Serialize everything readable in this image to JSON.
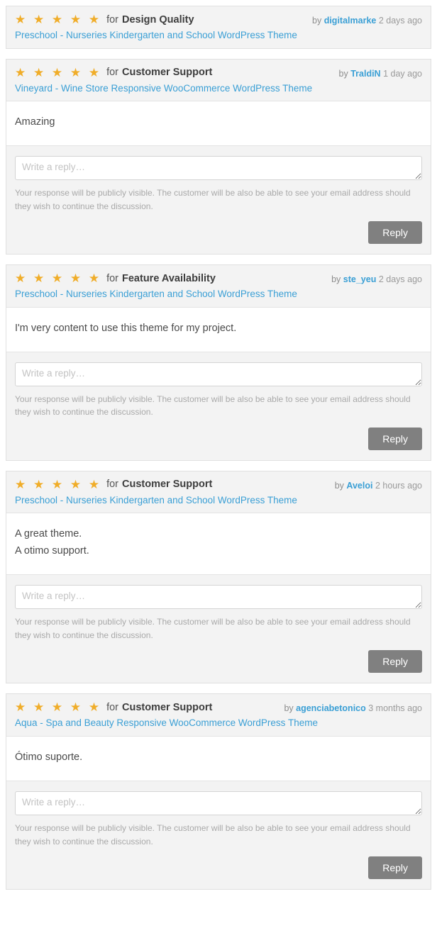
{
  "page": {
    "star_color": "#f0ad29",
    "link_color": "#3a9fd5",
    "button_color": "#808080",
    "header_bg": "#f3f3f3",
    "stars_glyphs": "★ ★ ★ ★ ★",
    "for_word": "for",
    "by_word": "by",
    "reply_placeholder": "Write a reply…",
    "reply_note": "Your response will be publicly visible. The customer will be also be able to see your email address should they wish to continue the discussion.",
    "reply_button_label": "Reply"
  },
  "reviews": [
    {
      "stars": 5,
      "criteria": "Design Quality",
      "author": "digitalmarke",
      "time_ago": "2 days ago",
      "item_title": "Preschool - Nurseries Kindergarten and School WordPress Theme",
      "body": "",
      "has_body": false,
      "has_reply_form": false
    },
    {
      "stars": 5,
      "criteria": "Customer Support",
      "author": "TraldiN",
      "time_ago": "1 day ago",
      "item_title": "Vineyard - Wine Store Responsive WooCommerce WordPress Theme",
      "body": "Amazing",
      "has_body": true,
      "has_reply_form": true
    },
    {
      "stars": 5,
      "criteria": "Feature Availability",
      "author": "ste_yeu",
      "time_ago": "2 days ago",
      "item_title": "Preschool - Nurseries Kindergarten and School WordPress Theme",
      "body": "I'm very content to use this theme for my project.",
      "has_body": true,
      "has_reply_form": true
    },
    {
      "stars": 5,
      "criteria": "Customer Support",
      "author": "Aveloi",
      "time_ago": "2 hours ago",
      "item_title": "Preschool - Nurseries Kindergarten and School WordPress Theme",
      "body": "A great theme.\nA otimo support.",
      "has_body": true,
      "has_reply_form": true
    },
    {
      "stars": 5,
      "criteria": "Customer Support",
      "author": "agenciabetonico",
      "time_ago": "3 months ago",
      "item_title": "Aqua - Spa and Beauty Responsive WooCommerce WordPress Theme",
      "body": "Ótimo suporte.",
      "has_body": true,
      "has_reply_form": true
    }
  ]
}
